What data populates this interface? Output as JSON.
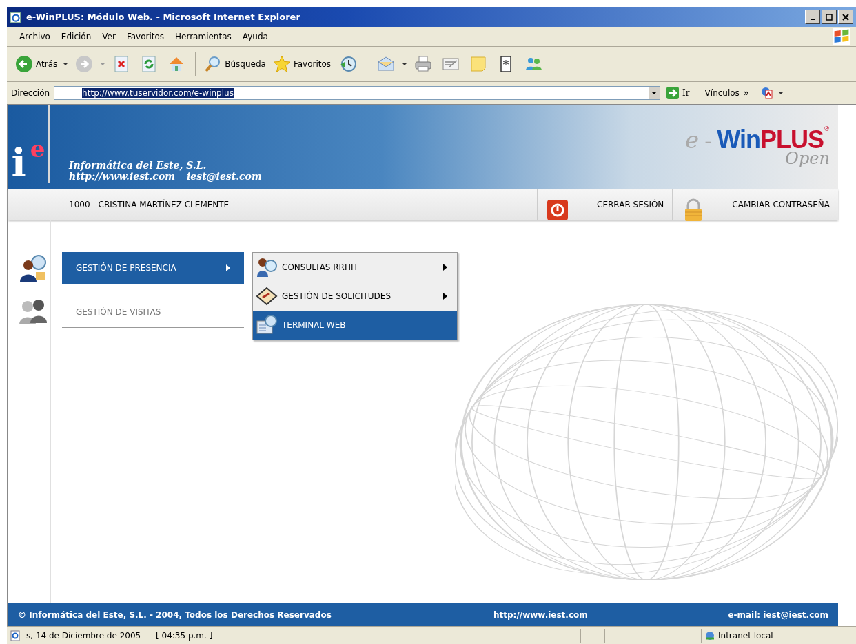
{
  "window": {
    "title": "e-WinPLUS: Módulo Web. - Microsoft Internet Explorer"
  },
  "menu_bar": [
    "Archivo",
    "Edición",
    "Ver",
    "Favoritos",
    "Herramientas",
    "Ayuda"
  ],
  "toolbar": {
    "back": "Atrás",
    "search": "Búsqueda",
    "favorites": "Favoritos"
  },
  "address_bar": {
    "label": "Dirección",
    "value": "http://www.tuservidor.com/e-winplus",
    "go": "Ir",
    "links": "Vínculos",
    "links_more": "»"
  },
  "header": {
    "logo_i": "i",
    "logo_e": "e",
    "company": "Informática del Este, S.L.",
    "website": "http://www.iest.com",
    "email": "iest@iest.com",
    "brand_prefix": "e",
    "brand_dash": "-",
    "brand_win": "Win",
    "brand_plus": "PLUS",
    "brand_reg": "®",
    "brand_sub": "Open"
  },
  "user_bar": {
    "user": "1000 - CRISTINA MARTÍNEZ CLEMENTE",
    "logout": "CERRAR SESIÓN",
    "change_password": "CAMBIAR CONTRASEÑA"
  },
  "main_menu": [
    {
      "label": "GESTIÓN DE PRESENCIA",
      "selected": true,
      "has_submenu": true
    },
    {
      "label": "GESTIÓN DE VISITAS",
      "selected": false,
      "has_submenu": false
    }
  ],
  "submenu": [
    {
      "label": "CONSULTAS RRHH",
      "selected": false,
      "has_submenu": true
    },
    {
      "label": "GESTIÓN DE SOLICITUDES",
      "selected": false,
      "has_submenu": true
    },
    {
      "label": "TERMINAL WEB",
      "selected": true,
      "has_submenu": false
    }
  ],
  "footer": {
    "copyright": "© Informática del Este, S.L. - 2004, Todos los Derechos Reservados",
    "website": "http://www.iest.com",
    "email": "e-mail: iest@iest.com"
  },
  "status_bar": {
    "date": "s, 14 de Diciembre de 2005",
    "time": "[ 04:35 p.m. ]",
    "zone": "Intranet local"
  }
}
